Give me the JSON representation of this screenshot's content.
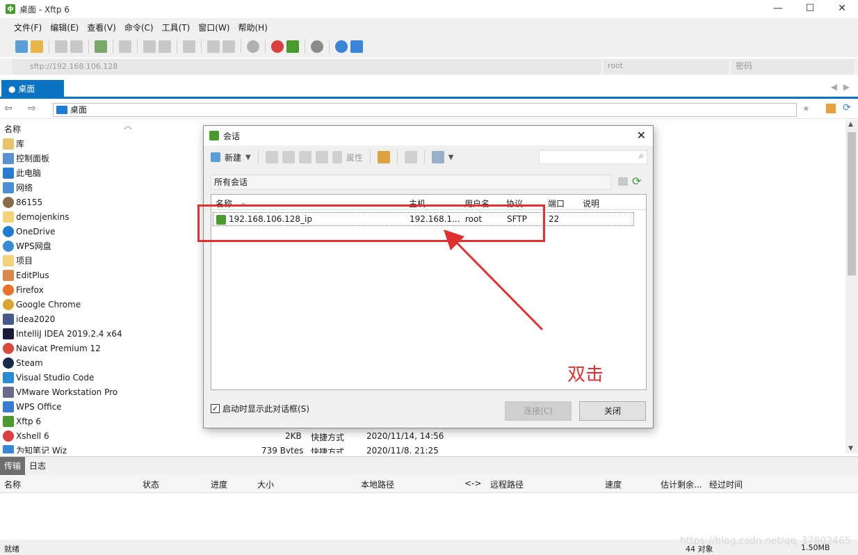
{
  "window": {
    "title": "桌面 - Xftp 6",
    "controls": [
      "—",
      "☐",
      "✕"
    ]
  },
  "menu": [
    "文件(F)",
    "编辑(E)",
    "查看(V)",
    "命令(C)",
    "工具(T)",
    "窗口(W)",
    "帮助(H)"
  ],
  "address": {
    "url": "sftp://192.168.106.128",
    "user": "root",
    "password_placeholder": "密码"
  },
  "tab": {
    "label": "桌面"
  },
  "nav": {
    "path": "桌面"
  },
  "file_pane": {
    "name_header": "名称",
    "items": [
      "库",
      "控制面板",
      "此电脑",
      "网络",
      "86155",
      "demojenkins",
      "OneDrive",
      "WPS网盘",
      "项目",
      "EditPlus",
      "Firefox",
      "Google Chrome",
      "idea2020",
      "IntelliJ IDEA 2019.2.4 x64",
      "Navicat Premium 12",
      "Steam",
      "Visual Studio Code",
      "VMware Workstation Pro",
      "WPS Office",
      "Xftp 6",
      "Xshell 6",
      "为知笔记 Wiz"
    ],
    "xshell_size": "2KB",
    "xshell_type": "快捷方式",
    "xshell_date": "2020/11/14, 14:56",
    "wiz_size": "739 Bytes",
    "wiz_type": "快捷方式",
    "wiz_date": "2020/11/8, 21:25"
  },
  "transfer": {
    "tabs": [
      "传输",
      "日志"
    ],
    "columns": [
      "名称",
      "状态",
      "进度",
      "大小",
      "本地路径",
      "<->",
      "远程路径",
      "速度",
      "估计剩余...",
      "经过时间"
    ]
  },
  "status": {
    "left": "就绪",
    "count": "44 对象",
    "size": "1.50MB"
  },
  "watermark": "https://blog.csdn.net/qq_37802465",
  "dialog": {
    "title": "会话",
    "new_label": "新建",
    "props_label": "属性",
    "all_sessions": "所有会话",
    "columns": [
      "名称",
      "主机",
      "用户名",
      "协议",
      "端口",
      "说明"
    ],
    "session": {
      "name": "192.168.106.128_ip",
      "host": "192.168.1...",
      "user": "root",
      "protocol": "SFTP",
      "port": "22"
    },
    "checkbox_label": "启动时显示此对话框(S)",
    "connect_label": "连接(C)",
    "close_label": "关闭"
  },
  "annotation": "双击"
}
